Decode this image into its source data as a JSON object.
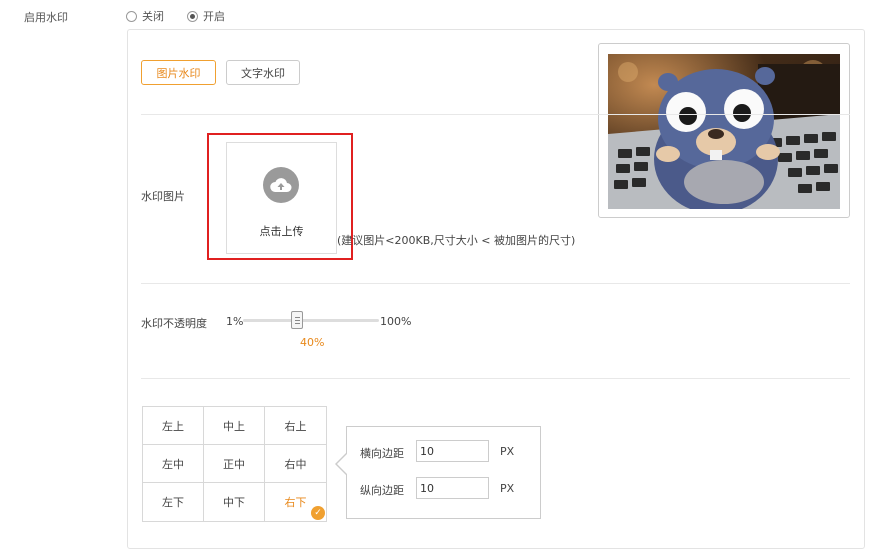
{
  "watermark_toggle": {
    "label": "启用水印",
    "options": [
      {
        "label": "关闭",
        "checked": false
      },
      {
        "label": "开启",
        "checked": true
      }
    ]
  },
  "tabs": [
    {
      "label": "图片水印",
      "active": true
    },
    {
      "label": "文字水印",
      "active": false
    }
  ],
  "image_row": {
    "label": "水印图片",
    "upload_label": "点击上传",
    "upload_icon": "cloud-upload-icon",
    "hint": "(建议图片<200KB,尺寸大小 < 被加图片的尺寸)"
  },
  "opacity_row": {
    "label": "水印不透明度",
    "min_label": "1%",
    "max_label": "100%",
    "value_label": "40%",
    "value_fraction": 0.4
  },
  "position_grid": {
    "cells": [
      "左上",
      "中上",
      "右上",
      "左中",
      "正中",
      "右中",
      "左下",
      "中下",
      "右下"
    ],
    "selected": "右下",
    "check_glyph": "✓"
  },
  "margins": {
    "horizontal_label": "横向边距",
    "horizontal_value": "10",
    "vertical_label": "纵向边距",
    "vertical_value": "10",
    "unit": "PX"
  },
  "colors": {
    "accent": "#e8891c",
    "highlight_frame": "#e02020"
  }
}
